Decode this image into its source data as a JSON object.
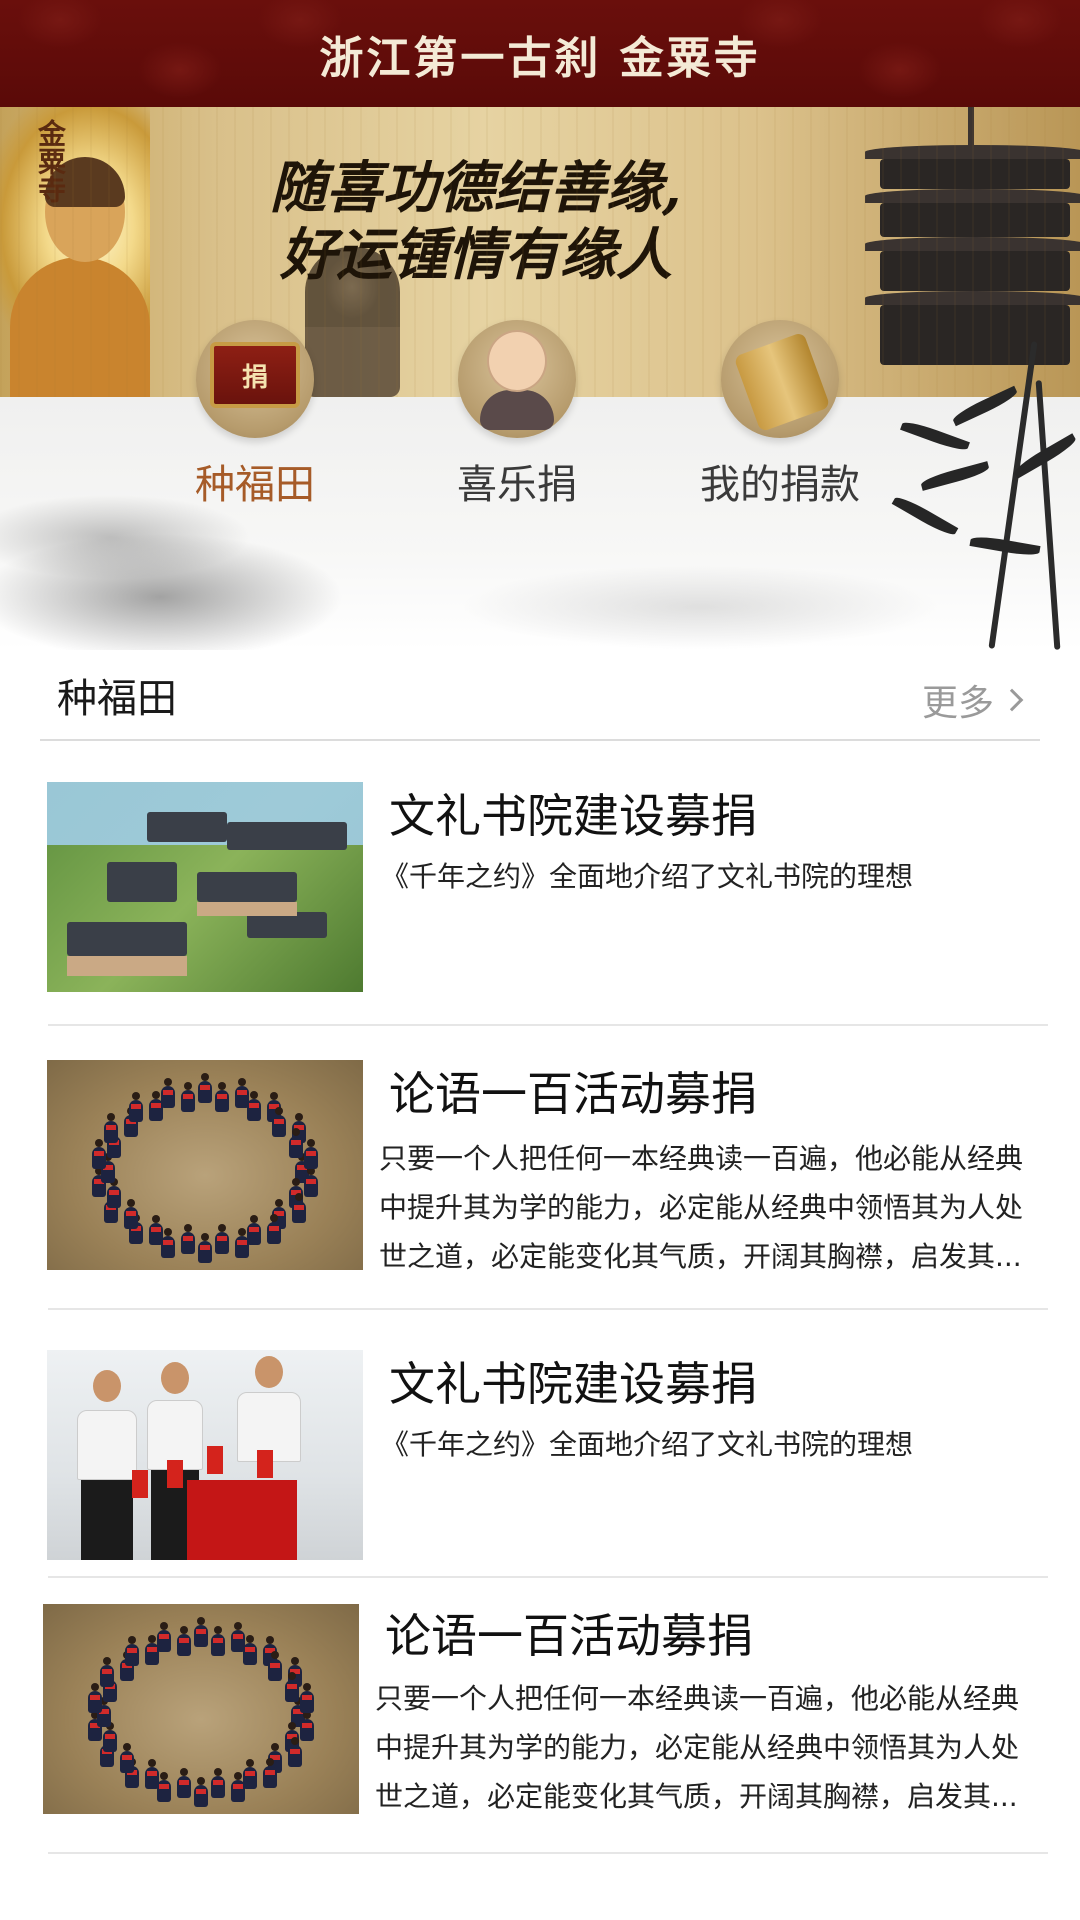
{
  "header": {
    "title": "浙江第一古刹 金粟寺"
  },
  "banner": {
    "slogan_line1": "随喜功德结善缘,",
    "slogan_line2": "好运锺情有缘人",
    "side_text": "金粟寺"
  },
  "nav": {
    "items": [
      {
        "label": "种福田",
        "icon": "donation-box-icon",
        "active": true
      },
      {
        "label": "喜乐捐",
        "icon": "monk-icon",
        "active": false
      },
      {
        "label": "我的捐款",
        "icon": "scroll-icon",
        "active": false
      }
    ],
    "box_glyph": "捐"
  },
  "section": {
    "title": "种福田",
    "more_label": "更多"
  },
  "items": [
    {
      "title": "文礼书院建设募捐",
      "desc": "《千年之约》全面地介绍了文礼书院的理想",
      "image": "campus-model"
    },
    {
      "title": "论语一百活动募捐",
      "desc": "只要一个人把任何一本经典读一百遍，他必能从经典中提升其为学的能力，必定能从经典中领悟其为人处世之道，必定能变化其气质，开阔其胸襟，启发其...",
      "image": "children-circle"
    },
    {
      "title": "文礼书院建设募捐",
      "desc": "《千年之约》全面地介绍了文礼书院的理想",
      "image": "donation-ceremony"
    },
    {
      "title": "论语一百活动募捐",
      "desc": "只要一个人把任何一本经典读一百遍，他必能从经典中提升其为学的能力，必定能从经典中领悟其为人处世之道，必定能变化其气质，开阔其胸襟，启发其...",
      "image": "children-circle"
    }
  ],
  "colors": {
    "header_bg": "#5a0a08",
    "active_nav": "#a65b28",
    "more_text": "#9a9a9a"
  }
}
